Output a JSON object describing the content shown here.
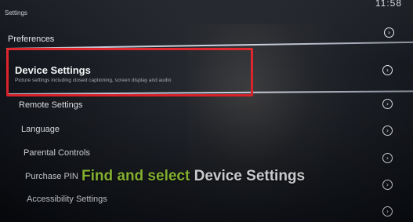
{
  "screen": {
    "header": "Settings",
    "clock": "11:58"
  },
  "menu": {
    "items": [
      {
        "label": "Preferences"
      },
      {
        "label": "Device Settings",
        "description": "Picture settings including closed captioning, screen display and audio",
        "selected": true
      },
      {
        "label": "Remote Settings"
      },
      {
        "label": "Language"
      },
      {
        "label": "Parental Controls"
      },
      {
        "label": "Purchase PIN"
      },
      {
        "label": "Accessibility Settings"
      }
    ],
    "chevron_icon": "chevron-right-circle-icon"
  },
  "overlay": {
    "caption_part1": "Find and select",
    "caption_part2": "Device Settings",
    "highlight_color": "#e0242b",
    "accent_color": "#9fd43a"
  }
}
